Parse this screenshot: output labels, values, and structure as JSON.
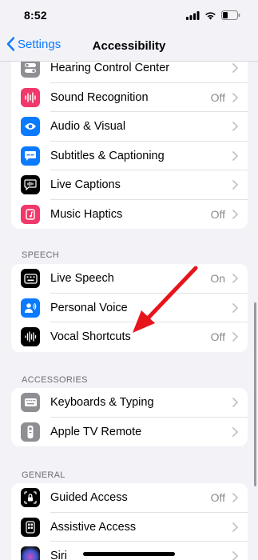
{
  "status": {
    "time": "8:52"
  },
  "nav": {
    "back_label": "Settings",
    "title": "Accessibility"
  },
  "group1": [
    {
      "label": "Hearing Control Center",
      "value": "",
      "icon": "toggles-icon",
      "color": "#8e8e93"
    },
    {
      "label": "Sound Recognition",
      "value": "Off",
      "icon": "waveform-icon",
      "color": "#f0386b"
    },
    {
      "label": "Audio & Visual",
      "value": "",
      "icon": "eye-audio-icon",
      "color": "#0a7aff"
    },
    {
      "label": "Subtitles & Captioning",
      "value": "",
      "icon": "caption-bubble-icon",
      "color": "#0a7aff"
    },
    {
      "label": "Live Captions",
      "value": "",
      "icon": "live-captions-icon",
      "color": "#000000"
    },
    {
      "label": "Music Haptics",
      "value": "Off",
      "icon": "music-haptics-icon",
      "color": "#f0386b"
    }
  ],
  "speech": {
    "header": "SPEECH",
    "items": [
      {
        "label": "Live Speech",
        "value": "On",
        "icon": "keyboard-speech-icon",
        "color": "#000000"
      },
      {
        "label": "Personal Voice",
        "value": "",
        "icon": "person-voice-icon",
        "color": "#0a7aff"
      },
      {
        "label": "Vocal Shortcuts",
        "value": "Off",
        "icon": "waveform-bars-icon",
        "color": "#000000"
      }
    ]
  },
  "accessories": {
    "header": "ACCESSORIES",
    "items": [
      {
        "label": "Keyboards & Typing",
        "value": "",
        "icon": "keyboard-icon",
        "color": "#8e8e93"
      },
      {
        "label": "Apple TV Remote",
        "value": "",
        "icon": "remote-icon",
        "color": "#8e8e93"
      }
    ]
  },
  "general": {
    "header": "GENERAL",
    "items": [
      {
        "label": "Guided Access",
        "value": "Off",
        "icon": "lock-frame-icon",
        "color": "#000000"
      },
      {
        "label": "Assistive Access",
        "value": "",
        "icon": "assistive-grid-icon",
        "color": "#000000"
      },
      {
        "label": "Siri",
        "value": "",
        "icon": "siri-icon",
        "color": "#1c1c1e"
      }
    ]
  },
  "annotation_color": "#e8141b"
}
